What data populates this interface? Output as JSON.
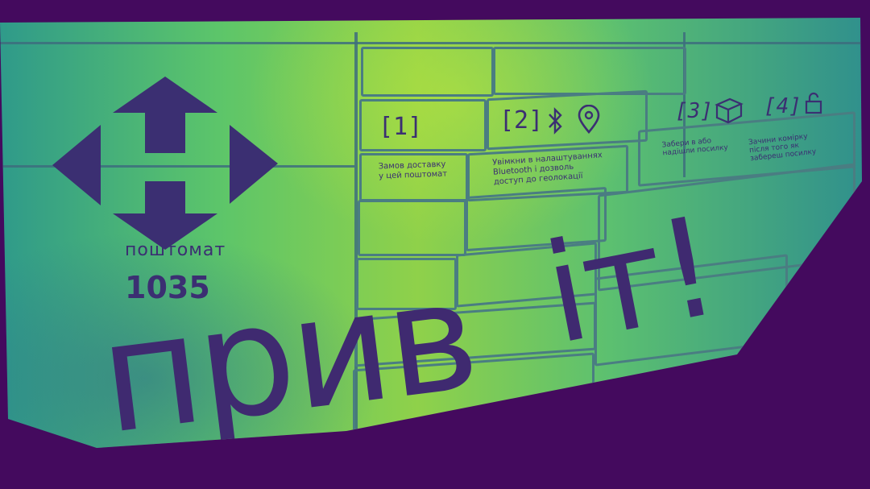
{
  "brand": {
    "word": "поштомат",
    "number": "1035"
  },
  "slots": [
    {
      "label": "[1]",
      "caption": "Замов доставку\nу цей поштомат"
    },
    {
      "label": "[2]",
      "caption": "Увімкни в налаштуваннях\nBluetooth і дозволь\nдоступ до геолокації"
    },
    {
      "label": "[3]",
      "caption": "Забери в або\nнадішли посилку"
    },
    {
      "label": "[4]",
      "caption": "Зачини комірку\nпісля того як\nзабереш посилку"
    }
  ],
  "greeting": {
    "part1": "прив",
    "part2": "іт!"
  },
  "icons": [
    "bluetooth-icon",
    "location-pin-icon",
    "box-icon",
    "padlock-icon"
  ],
  "colors": {
    "background": "#440a5e",
    "ink": "#3b2f72",
    "panel_light": "#8fd14a",
    "panel_dark": "#2f8f8d"
  }
}
